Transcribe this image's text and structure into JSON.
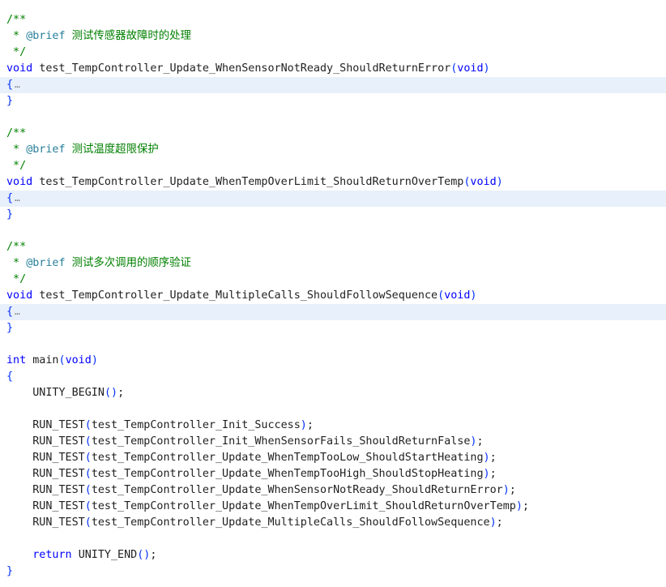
{
  "colors": {
    "comment": "#008000",
    "doc_tag": "#267f99",
    "keyword": "#0000ff",
    "text": "#1f1f1f",
    "paren": "#0431fa",
    "fold_highlight": "#e8f0fb"
  },
  "fold_placeholder": "…",
  "blocks": [
    {
      "comment_open": "/**",
      "brief_prefix": " * ",
      "brief_tag": "@brief",
      "brief_text": " 测试传感器故障时的处理",
      "comment_close": " */",
      "return_type": "void",
      "name": "test_TempController_Update_WhenSensorNotReady_ShouldReturnError",
      "param": "void",
      "open_brace": "{",
      "close_brace": "}"
    },
    {
      "comment_open": "/**",
      "brief_prefix": " * ",
      "brief_tag": "@brief",
      "brief_text": " 测试温度超限保护",
      "comment_close": " */",
      "return_type": "void",
      "name": "test_TempController_Update_WhenTempOverLimit_ShouldReturnOverTemp",
      "param": "void",
      "open_brace": "{",
      "close_brace": "}"
    },
    {
      "comment_open": "/**",
      "brief_prefix": " * ",
      "brief_tag": "@brief",
      "brief_text": " 测试多次调用的顺序验证",
      "comment_close": " */",
      "return_type": "void",
      "name": "test_TempController_Update_MultipleCalls_ShouldFollowSequence",
      "param": "void",
      "open_brace": "{",
      "close_brace": "}"
    }
  ],
  "main": {
    "return_type": "int",
    "name": "main",
    "param": "void",
    "open_brace": "{",
    "close_brace": "}",
    "begin_call": "UNITY_BEGIN",
    "run_macro": "RUN_TEST",
    "tests": [
      "test_TempController_Init_Success",
      "test_TempController_Init_WhenSensorFails_ShouldReturnFalse",
      "test_TempController_Update_WhenTempTooLow_ShouldStartHeating",
      "test_TempController_Update_WhenTempTooHigh_ShouldStopHeating",
      "test_TempController_Update_WhenSensorNotReady_ShouldReturnError",
      "test_TempController_Update_WhenTempOverLimit_ShouldReturnOverTemp",
      "test_TempController_Update_MultipleCalls_ShouldFollowSequence"
    ],
    "return_keyword": "return",
    "end_call": "UNITY_END"
  }
}
